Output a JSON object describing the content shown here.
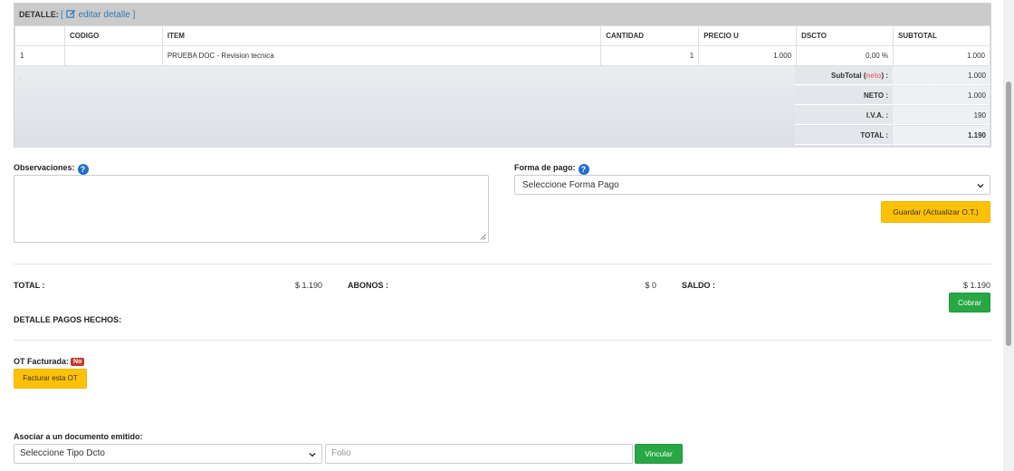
{
  "detail": {
    "title": "DETALLE:",
    "edit_open": "[",
    "edit_label": "editar detalle",
    "edit_close": "]",
    "columns": [
      "",
      "CODIGO",
      "ITEM",
      "CANTIDAD",
      "PRECIO U",
      "DSCTO",
      "SUBTOTAL"
    ],
    "rows": [
      {
        "n": "1",
        "codigo": "",
        "item": "PRUEBA DOC - Revision tecnica",
        "cantidad": "1",
        "precio": "1.000",
        "dscto": "0,00 %",
        "subtotal": "1.000"
      }
    ],
    "dot": ".",
    "totals": {
      "subtotal_label": "SubTotal (",
      "subtotal_neto": "neto",
      "subtotal_close": ") :",
      "subtotal_value": "1.000",
      "neto_label": "NETO :",
      "neto_value": "1.000",
      "iva_label": "I.V.A. :",
      "iva_value": "190",
      "total_label": "TOTAL :",
      "total_value": "1.190"
    }
  },
  "form": {
    "observaciones_label": "Observaciones:",
    "forma_pago_label": "Forma de pago:",
    "forma_pago_value": "Seleccione Forma Pago",
    "guardar_button": "Guardar (Actualizar O.T.)"
  },
  "summary": {
    "total_label": "TOTAL :",
    "total_value": "$ 1.190",
    "abonos_label": "ABONOS :",
    "abonos_value": "$ 0",
    "saldo_label": "SALDO :",
    "saldo_value": "$ 1.190",
    "cobrar_button": "Cobrar",
    "detalle_pagos_label": "DETALLE PAGOS HECHOS:"
  },
  "facturacion": {
    "ot_facturada_label": "OT Facturada:",
    "badge": "No",
    "facturar_button": "Facturar esta OT"
  },
  "asociar": {
    "label": "Asociar a un documento emitido:",
    "tipo_select": "Seleccione Tipo Dcto",
    "folio_placeholder": "Folio",
    "vincular_button": "Vincular"
  },
  "icons": {
    "edit": "edit-icon",
    "help": "question-circle-icon",
    "chevron": "chevron-down-icon"
  },
  "colors": {
    "link": "#337ab7",
    "warning": "#ffc107",
    "success": "#28a745",
    "danger_badge": "#c0392b",
    "help_icon": "#1e6fd0"
  }
}
